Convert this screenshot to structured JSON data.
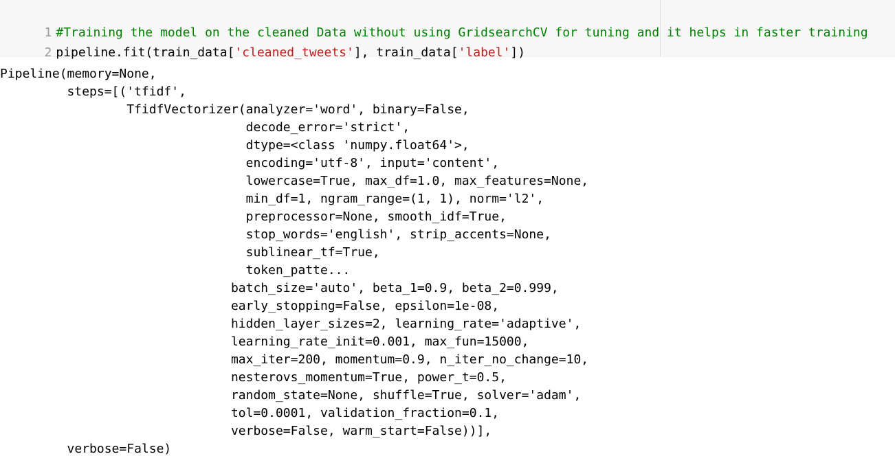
{
  "input_cell": {
    "lines": [
      {
        "number": "1",
        "comment": "#Training the model on the cleaned Data without using GridsearchCV for tuning and it helps in faster training"
      },
      {
        "number": "2",
        "parts": {
          "a": "pipeline.fit(train_data[",
          "b": "'cleaned_tweets'",
          "c": "], train_data[",
          "d": "'label'",
          "e": "])"
        }
      }
    ]
  },
  "output": {
    "lines": [
      "Pipeline(memory=None,",
      "         steps=[('tfidf',",
      "                 TfidfVectorizer(analyzer='word', binary=False,",
      "                                 decode_error='strict',",
      "                                 dtype=<class 'numpy.float64'>,",
      "                                 encoding='utf-8', input='content',",
      "                                 lowercase=True, max_df=1.0, max_features=None,",
      "                                 min_df=1, ngram_range=(1, 1), norm='l2',",
      "                                 preprocessor=None, smooth_idf=True,",
      "                                 stop_words='english', strip_accents=None,",
      "                                 sublinear_tf=True,",
      "                                 token_patte...",
      "                               batch_size='auto', beta_1=0.9, beta_2=0.999,",
      "                               early_stopping=False, epsilon=1e-08,",
      "                               hidden_layer_sizes=2, learning_rate='adaptive',",
      "                               learning_rate_init=0.001, max_fun=15000,",
      "                               max_iter=200, momentum=0.9, n_iter_no_change=10,",
      "                               nesterovs_momentum=True, power_t=0.5,",
      "                               random_state=None, shuffle=True, solver='adam',",
      "                               tol=0.0001, validation_fraction=0.1,",
      "                               verbose=False, warm_start=False))],",
      "         verbose=False)"
    ]
  }
}
